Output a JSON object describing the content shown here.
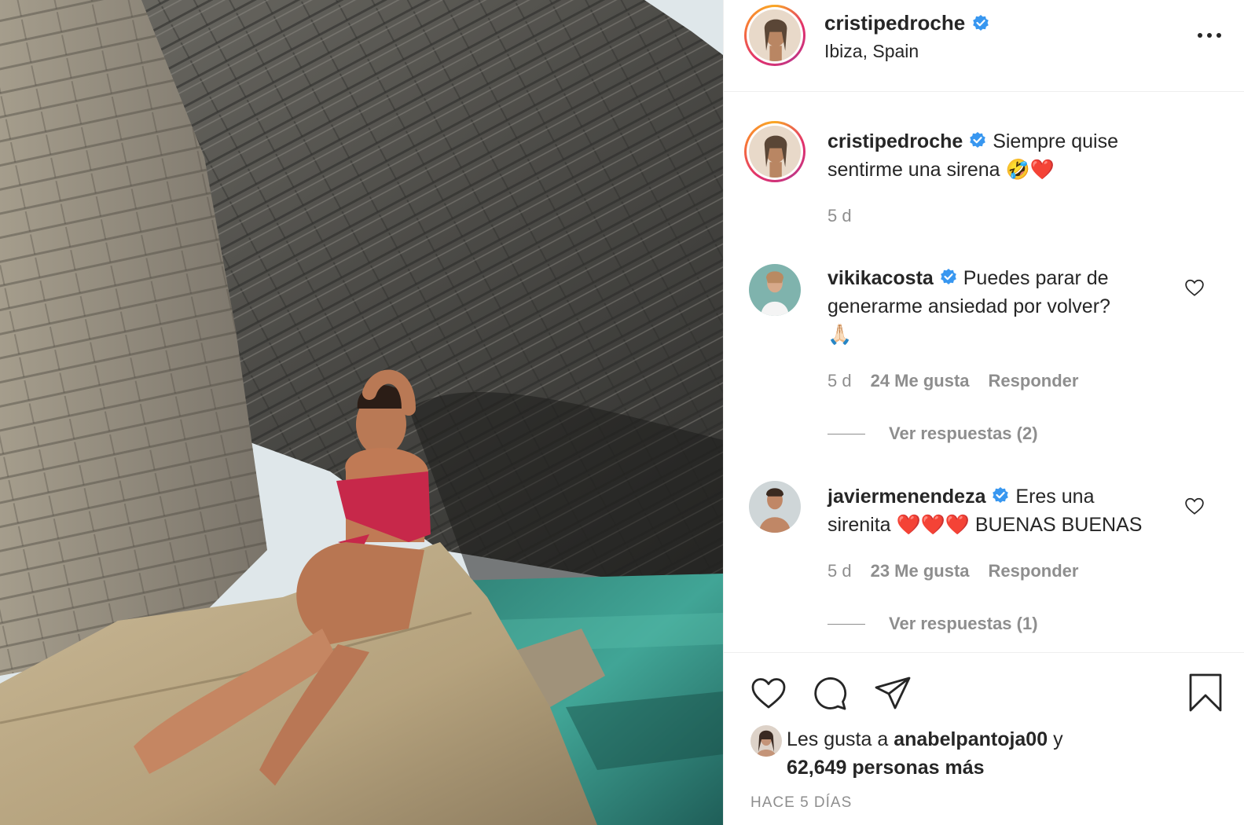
{
  "post": {
    "username": "cristipedroche",
    "location": "Ibiza, Spain",
    "more_icon": "more-horizontal-icon"
  },
  "caption": {
    "username": "cristipedroche",
    "text_line1": "Siempre quise",
    "text_line2": "sentirme una sirena 🤣❤️",
    "time": "5 d"
  },
  "comments": [
    {
      "username": "vikikacosta",
      "text_line1": "Puedes parar de",
      "text_line2": "generarme ansiedad por volver?",
      "text_line3": "🙏🏻",
      "time": "5 d",
      "likes": "24 Me gusta",
      "reply": "Responder",
      "view_replies": "Ver respuestas (2)"
    },
    {
      "username": "javiermenendeza",
      "text_line1": "Eres una",
      "text_line2": "sirenita ❤️❤️❤️ BUENAS BUENAS",
      "time": "5 d",
      "likes": "23 Me gusta",
      "reply": "Responder",
      "view_replies": "Ver respuestas (1)"
    }
  ],
  "actions": {
    "like_icon": "heart-icon",
    "comment_icon": "comment-icon",
    "share_icon": "paper-plane-icon",
    "save_icon": "bookmark-icon"
  },
  "likes": {
    "prefix": "Les gusta a ",
    "user": "anabelpantoja00",
    "suffix": " y",
    "others": "62,649 personas más"
  },
  "timestamp": "HACE 5 DÍAS",
  "colors": {
    "text": "#262626",
    "secondary": "#8e8e8e",
    "verified": "#3897f0",
    "border": "#efefef"
  }
}
